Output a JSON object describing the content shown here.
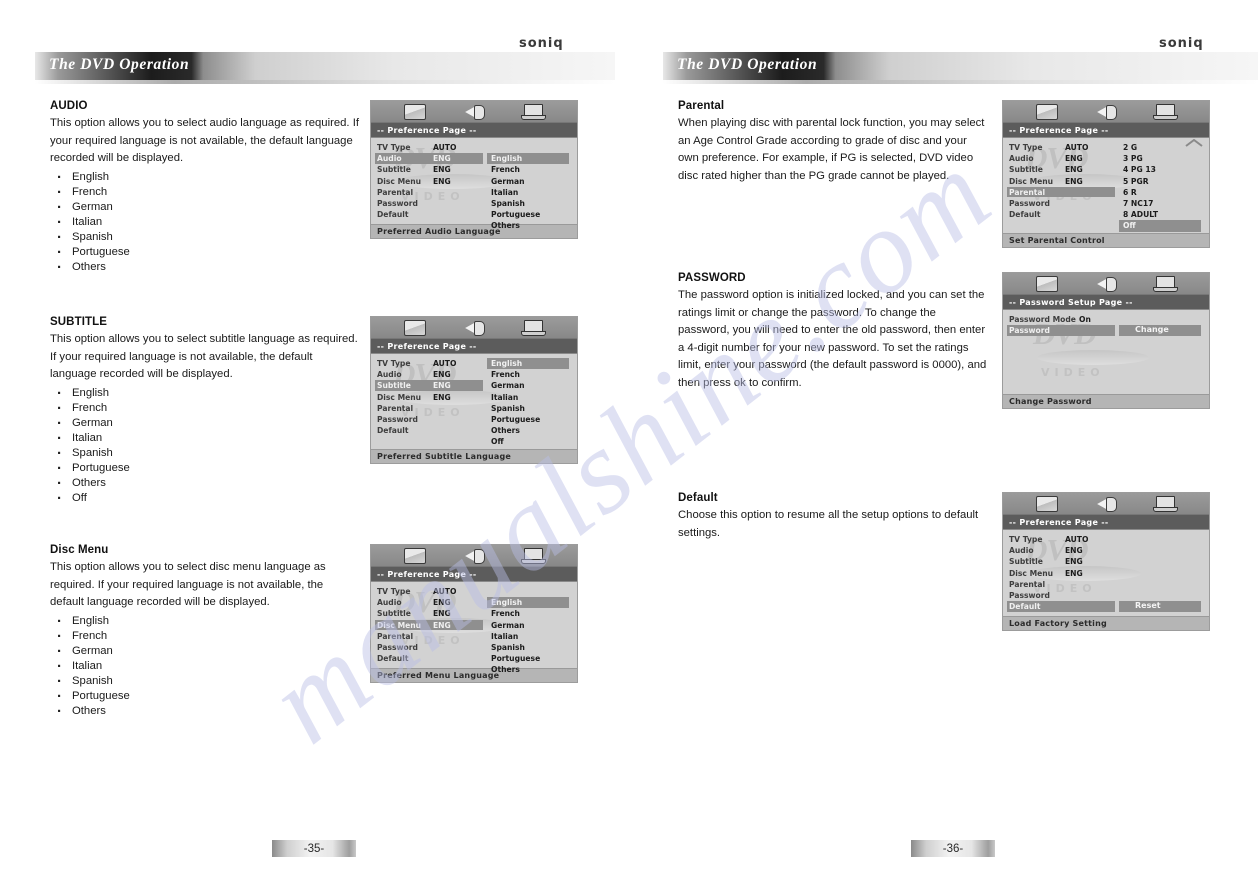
{
  "document": {
    "brand_logo": "soniq",
    "header_title": "The DVD Operation",
    "watermark": "manualshine.com"
  },
  "osd_common": {
    "icons": [
      "picture-icon",
      "speaker-icon",
      "preferences-icon"
    ],
    "page_title": "-- Preference Page --",
    "rows": [
      "TV Type",
      "Audio",
      "Subtitle",
      "Disc Menu",
      "Parental",
      "Password",
      "Default"
    ],
    "values": [
      "AUTO",
      "ENG",
      "ENG",
      "ENG",
      "",
      "",
      ""
    ],
    "dvd_logo_top": "DVD",
    "dvd_logo_bottom": "VIDEO"
  },
  "left_page": {
    "page_number": "-35-",
    "sections": [
      {
        "title": "AUDIO",
        "body": "This option allows you to select audio language as required. If your required language is not available, the default language recorded will be displayed.",
        "bullets": [
          "English",
          "French",
          "German",
          "Italian",
          "Spanish",
          "Portuguese",
          "Others"
        ],
        "osd": {
          "page_title": "-- Preference Page --",
          "selected_row": "Audio",
          "options": [
            "English",
            "French",
            "German",
            "Italian",
            "Spanish",
            "Portuguese",
            "Others"
          ],
          "highlighted_option": "English",
          "options_start_row": 1,
          "footer": "Preferred Audio Language"
        }
      },
      {
        "title": "SUBTITLE",
        "body": "This option allows you to select subtitle language as required. If your required language is not available, the default language recorded will be displayed.",
        "bullets": [
          "English",
          "French",
          "German",
          "Italian",
          "Spanish",
          "Portuguese",
          "Others",
          "Off"
        ],
        "osd": {
          "page_title": "-- Preference Page --",
          "selected_row": "Subtitle",
          "options": [
            "English",
            "French",
            "German",
            "Italian",
            "Spanish",
            "Portuguese",
            "Others",
            "Off"
          ],
          "highlighted_option": "English",
          "options_start_row": 0,
          "footer": "Preferred Subtitle Language"
        }
      },
      {
        "title": "Disc Menu",
        "body": "This option allows you to select disc menu language as required. If your required language is not available, the default language recorded will be displayed.",
        "bullets": [
          "English",
          "French",
          "German",
          "Italian",
          "Spanish",
          "Portuguese",
          "Others"
        ],
        "osd": {
          "page_title": "-- Preference Page --",
          "selected_row": "Disc Menu",
          "options": [
            "English",
            "French",
            "German",
            "Italian",
            "Spanish",
            "Portuguese",
            "Others"
          ],
          "highlighted_option": "English",
          "options_start_row": 1,
          "footer": "Preferred Menu Language"
        }
      }
    ]
  },
  "right_page": {
    "page_number": "-36-",
    "sections": [
      {
        "title": "Parental",
        "body": "When playing disc with parental lock function, you may select an Age Control Grade according to grade of disc and your own preference. For example, if PG is selected, DVD video disc rated higher than the PG grade cannot be played.",
        "bullets": [],
        "osd": {
          "page_title": "-- Preference Page --",
          "selected_row": "Parental",
          "options": [
            "2 G",
            "3 PG",
            "4 PG 13",
            "5 PGR",
            "6 R",
            "7 NC17",
            "8 ADULT",
            "Off"
          ],
          "highlighted_option": "Off",
          "options_start_row": 0,
          "scroll_arrow": "up-arrow-icon",
          "footer": "Set Parental Control"
        }
      },
      {
        "title": "PASSWORD",
        "body": "The password option is initialized locked, and you can set the ratings limit or change the password. To change the password, you will need to enter the old password, then enter a 4-digit number for your new password. To set the ratings limit, enter your password (the default password is 0000), and then press ok to confirm.",
        "bullets": [],
        "osd": {
          "page_title": "-- Password Setup Page --",
          "password_rows": [
            "Password Mode",
            "Password"
          ],
          "password_mode_value": "On",
          "selected_row": "Password",
          "button_label": "Change",
          "footer": "Change Password"
        }
      },
      {
        "title": "Default",
        "body": "Choose this option to resume all the setup options to default settings.",
        "bullets": [],
        "osd": {
          "page_title": "-- Preference Page --",
          "selected_row": "Default",
          "button_label": "Reset",
          "footer": "Load Factory Setting"
        }
      }
    ]
  }
}
